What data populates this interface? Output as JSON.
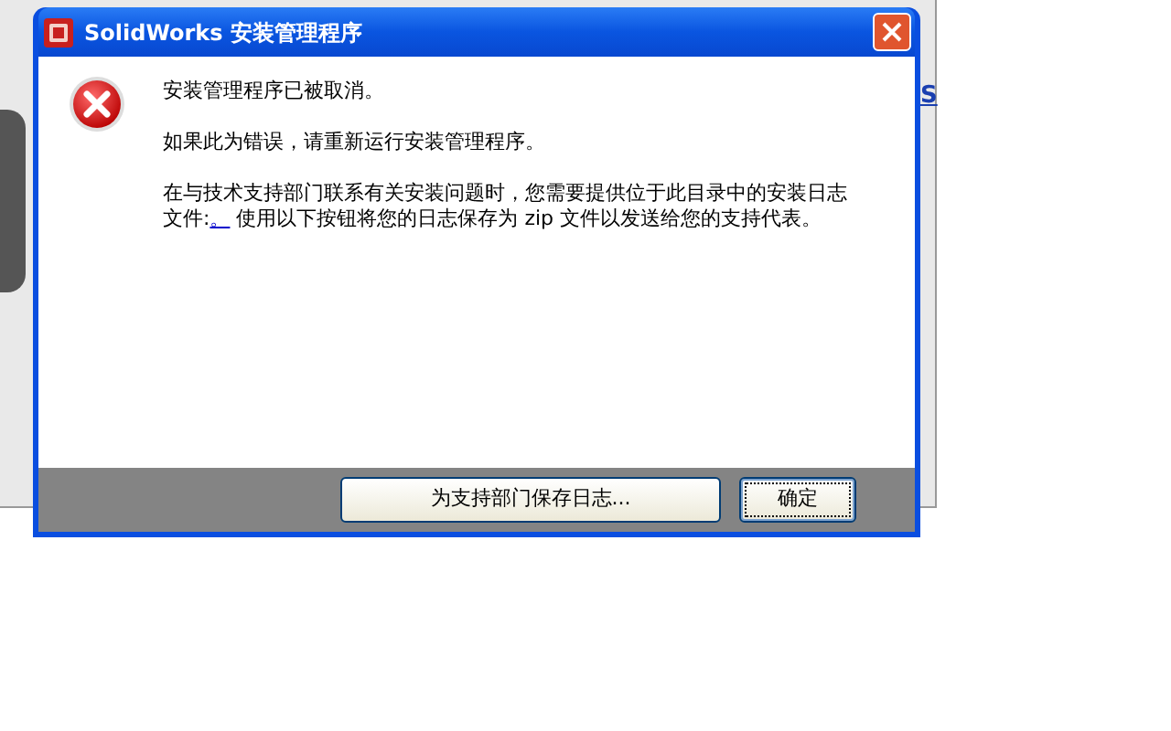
{
  "background": {
    "link_fragment": "S"
  },
  "window": {
    "title": "SolidWorks 安装管理程序"
  },
  "message": {
    "lines": [
      "安装管理程序已被取消。",
      "如果此为错误，请重新运行安装管理程序。"
    ],
    "detail": {
      "before": "在与技术支持部门联系有关安装问题时，您需要提供位于此目录中的安装日志文件:",
      "link": "。",
      "after": " 使用以下按钮将您的日志保存为 zip 文件以发送给您的支持代表。"
    }
  },
  "buttons": [
    {
      "label": "为支持部门保存日志...",
      "focused": false
    },
    {
      "label": "确定",
      "focused": true
    }
  ]
}
